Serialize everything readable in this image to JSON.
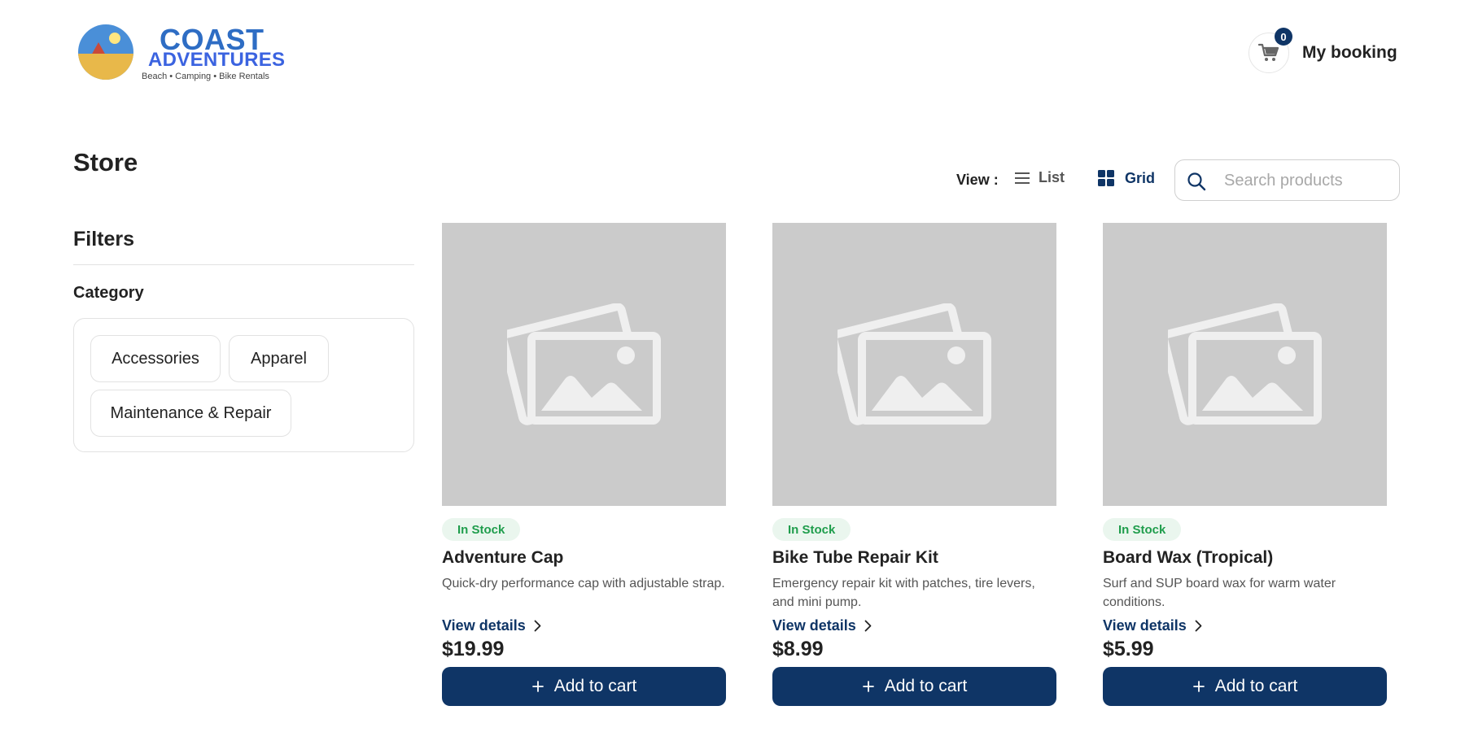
{
  "brand": {
    "name_line1": "COAST",
    "name_line2": "ADVENTURES",
    "tagline": "Beach • Camping • Bike Rentals",
    "colors": {
      "primary": "#0f3566",
      "logo_blue": "#2e6dc4",
      "stock_green": "#1f9d4c"
    }
  },
  "header": {
    "cart_count": "0",
    "my_booking_label": "My booking",
    "cart_icon": "cart-icon"
  },
  "page": {
    "title": "Store"
  },
  "toolbar": {
    "view_label": "View :",
    "list_label": "List",
    "grid_label": "Grid",
    "active_view": "Grid",
    "search_placeholder": "Search products",
    "search_value": ""
  },
  "filters": {
    "title": "Filters",
    "category_title": "Category",
    "categories": [
      "Accessories",
      "Apparel",
      "Maintenance & Repair"
    ]
  },
  "products": [
    {
      "stock": "In Stock",
      "name": "Adventure Cap",
      "description": "Quick-dry performance cap with adjustable strap.",
      "view_details": "View details",
      "price": "$19.99",
      "add_label": "Add to cart"
    },
    {
      "stock": "In Stock",
      "name": "Bike Tube Repair Kit",
      "description": "Emergency repair kit with patches, tire levers, and mini pump.",
      "view_details": "View details",
      "price": "$8.99",
      "add_label": "Add to cart"
    },
    {
      "stock": "In Stock",
      "name": "Board Wax (Tropical)",
      "description": "Surf and SUP board wax for warm water conditions.",
      "view_details": "View details",
      "price": "$5.99",
      "add_label": "Add to cart"
    }
  ]
}
